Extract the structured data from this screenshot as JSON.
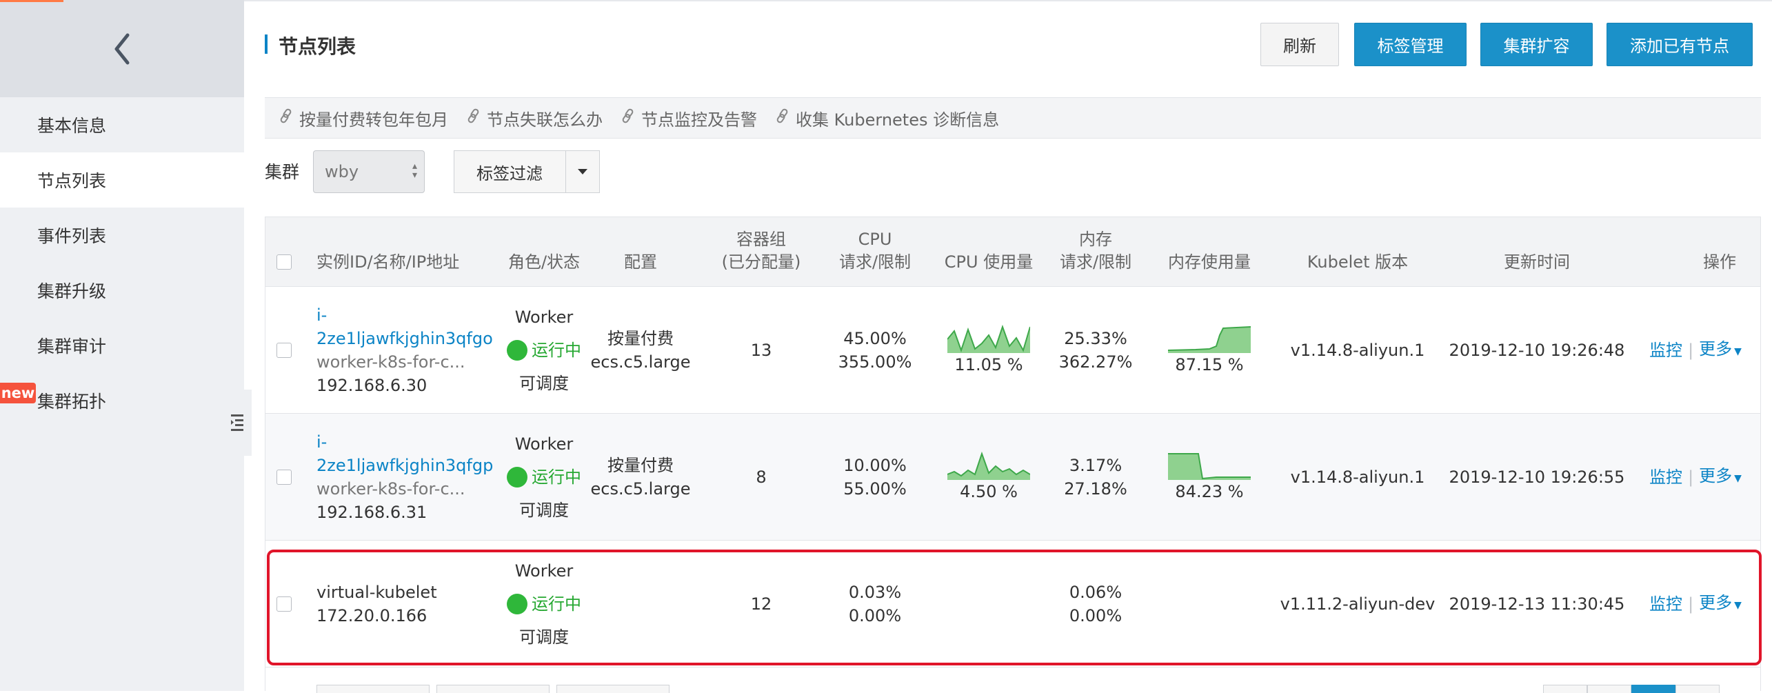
{
  "sidebar": {
    "back_icon": "chevron-left-icon",
    "items": [
      {
        "label": "基本信息",
        "active": false
      },
      {
        "label": "节点列表",
        "active": true
      },
      {
        "label": "事件列表",
        "active": false
      },
      {
        "label": "集群升级",
        "active": false
      },
      {
        "label": "集群审计",
        "active": false
      },
      {
        "label": "集群拓扑",
        "active": false,
        "badge": "new"
      }
    ],
    "collapse_icon": "menu-collapse-icon"
  },
  "header": {
    "title": "节点列表",
    "buttons": {
      "refresh": "刷新",
      "tag_manage": "标签管理",
      "scale_out": "集群扩容",
      "add_node": "添加已有节点"
    }
  },
  "help_links": [
    {
      "label": "按量付费转包年包月",
      "icon": "link-icon"
    },
    {
      "label": "节点失联怎么办",
      "icon": "link-icon"
    },
    {
      "label": "节点监控及告警",
      "icon": "link-icon"
    },
    {
      "label": "收集 Kubernetes 诊断信息",
      "icon": "link-icon"
    }
  ],
  "filter": {
    "cluster_label": "集群",
    "cluster_value": "wby",
    "tag_filter_label": "标签过滤"
  },
  "table": {
    "columns": {
      "instance": "实例ID/名称/IP地址",
      "role": "角色/状态",
      "config": "配置",
      "pods_line1": "容器组",
      "pods_line2": "(已分配量)",
      "cpu_req_line1": "CPU",
      "cpu_req_line2": "请求/限制",
      "cpu_usage": "CPU 使用量",
      "mem_req_line1": "内存",
      "mem_req_line2": "请求/限制",
      "mem_usage": "内存使用量",
      "kubelet": "Kubelet 版本",
      "updated": "更新时间",
      "ops": "操作"
    },
    "rows": [
      {
        "instance_id": "i-2ze1ljawfkjghin3qfgo",
        "name": "worker-k8s-for-c...",
        "ip": "192.168.6.30",
        "role": "Worker",
        "status": "运行中",
        "schedulable": "可调度",
        "billing": "按量付费",
        "instance_type": "ecs.c5.large",
        "pods": "13",
        "cpu_request": "45.00%",
        "cpu_limit": "355.00%",
        "cpu_usage": "11.05 %",
        "mem_request": "25.33%",
        "mem_limit": "362.27%",
        "mem_usage": "87.15 %",
        "kubelet": "v1.14.8-aliyun.1",
        "updated": "2019-12-10 19:26:48",
        "op_monitor": "监控",
        "op_more": "更多"
      },
      {
        "instance_id": "i-2ze1ljawfkjghin3qfgp",
        "name": "worker-k8s-for-c...",
        "ip": "192.168.6.31",
        "role": "Worker",
        "status": "运行中",
        "schedulable": "可调度",
        "billing": "按量付费",
        "instance_type": "ecs.c5.large",
        "pods": "8",
        "cpu_request": "10.00%",
        "cpu_limit": "55.00%",
        "cpu_usage": "4.50 %",
        "mem_request": "3.17%",
        "mem_limit": "27.18%",
        "mem_usage": "84.23 %",
        "kubelet": "v1.14.8-aliyun.1",
        "updated": "2019-12-10 19:26:55",
        "op_monitor": "监控",
        "op_more": "更多"
      },
      {
        "name": "virtual-kubelet",
        "ip": "172.20.0.166",
        "role": "Worker",
        "status": "运行中",
        "schedulable": "可调度",
        "pods": "12",
        "cpu_request": "0.03%",
        "cpu_limit": "0.00%",
        "mem_request": "0.06%",
        "mem_limit": "0.00%",
        "kubelet": "v1.11.2-aliyun-dev",
        "updated": "2019-12-13 11:30:45",
        "op_monitor": "监控",
        "op_more": "更多"
      }
    ]
  },
  "colors": {
    "primary": "#1b91c9",
    "link": "#0c84c6",
    "status_green": "#2fb73a",
    "highlight_red": "#e0152a",
    "new_badge": "#f5533d",
    "sparkline_fill": "#8fd18f"
  }
}
